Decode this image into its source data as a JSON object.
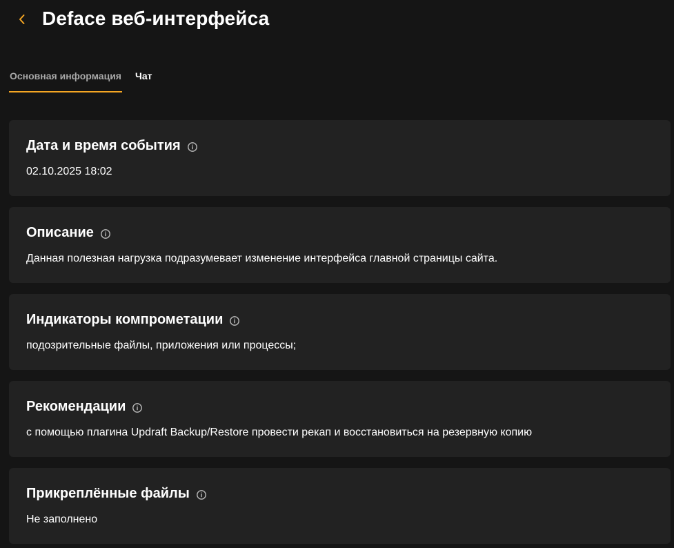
{
  "header": {
    "title": "Deface веб-интерфейса",
    "back_icon": "chevron-left-icon",
    "accent_color": "#f5a623"
  },
  "tabs": [
    {
      "label": "Основная информация",
      "active": true
    },
    {
      "label": "Чат",
      "active": false
    }
  ],
  "sections": [
    {
      "title": "Дата и время события",
      "value": "02.10.2025 18:02",
      "icon": "info-icon"
    },
    {
      "title": "Описание",
      "value": "Данная полезная нагрузка подразумевает изменение интерфейса главной страницы сайта.",
      "icon": "info-icon"
    },
    {
      "title": "Индикаторы компрометации",
      "value": "подозрительные файлы, приложения или процессы;",
      "icon": "info-icon"
    },
    {
      "title": "Рекомендации",
      "value": "с помощью плагина Updraft Backup/Restore провести рекап и восстановиться на резервную копию",
      "icon": "info-icon"
    },
    {
      "title": "Прикреплённые файлы",
      "value": "Не заполнено",
      "icon": "info-icon"
    }
  ]
}
